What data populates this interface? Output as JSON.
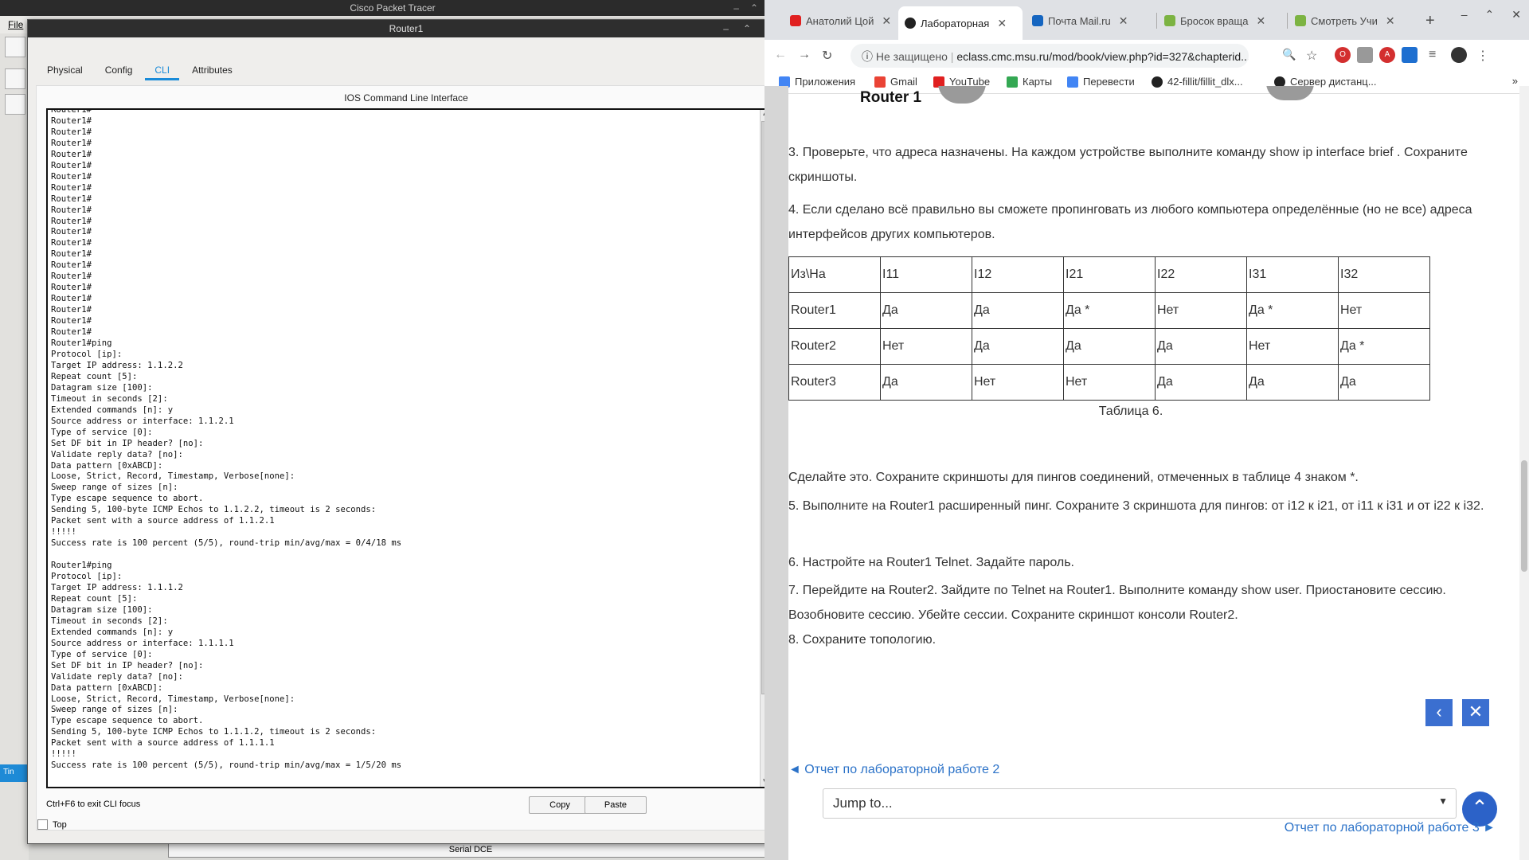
{
  "pt": {
    "app_title": "Cisco Packet Tracer",
    "menu_file": "File",
    "bottom_label": "Serial DCE",
    "side_tool_label": "Tin"
  },
  "dialog": {
    "title": "Router1",
    "tabs": [
      "Physical",
      "Config",
      "CLI",
      "Attributes"
    ],
    "active_tab": "CLI",
    "heading": "IOS Command Line Interface",
    "hint": "Ctrl+F6 to exit CLI focus",
    "copy_label": "Copy",
    "paste_label": "Paste",
    "top_label": "Top",
    "cli_text": "Router1#\nRouter1#\nRouter1#\nRouter1#\nRouter1#\nRouter1#\nRouter1#\nRouter1#\nRouter1#\nRouter1#\nRouter1#\nRouter1#\nRouter1#\nRouter1#\nRouter1#\nRouter1#\nRouter1#\nRouter1#\nRouter1#\nRouter1#\nRouter1#\nRouter1#ping\nProtocol [ip]:\nTarget IP address: 1.1.2.2\nRepeat count [5]:\nDatagram size [100]:\nTimeout in seconds [2]:\nExtended commands [n]: y\nSource address or interface: 1.1.2.1\nType of service [0]:\nSet DF bit in IP header? [no]:\nValidate reply data? [no]:\nData pattern [0xABCD]:\nLoose, Strict, Record, Timestamp, Verbose[none]:\nSweep range of sizes [n]:\nType escape sequence to abort.\nSending 5, 100-byte ICMP Echos to 1.1.2.2, timeout is 2 seconds:\nPacket sent with a source address of 1.1.2.1\n!!!!!\nSuccess rate is 100 percent (5/5), round-trip min/avg/max = 0/4/18 ms\n\nRouter1#ping\nProtocol [ip]:\nTarget IP address: 1.1.1.2\nRepeat count [5]:\nDatagram size [100]:\nTimeout in seconds [2]:\nExtended commands [n]: y\nSource address or interface: 1.1.1.1\nType of service [0]:\nSet DF bit in IP header? [no]:\nValidate reply data? [no]:\nData pattern [0xABCD]:\nLoose, Strict, Record, Timestamp, Verbose[none]:\nSweep range of sizes [n]:\nType escape sequence to abort.\nSending 5, 100-byte ICMP Echos to 1.1.1.2, timeout is 2 seconds:\nPacket sent with a source address of 1.1.1.1\n!!!!!\nSuccess rate is 100 percent (5/5), round-trip min/avg/max = 1/5/20 ms"
  },
  "browser": {
    "tabs": [
      {
        "label": "Анатолий Цой",
        "color": "#e02020"
      },
      {
        "label": "Лабораторная",
        "color": "#222222"
      },
      {
        "label": "Почта Mail.ru",
        "color": "#1565c0"
      },
      {
        "label": "Бросок враща",
        "color": "#7cb342"
      },
      {
        "label": "Смотреть Учи",
        "color": "#7cb342"
      }
    ],
    "security": "Не защищено",
    "url": "eclass.cmc.msu.ru/mod/book/view.php?id=327&chapterid...",
    "bookmarks": [
      "Приложения",
      "Gmail",
      "YouTube",
      "Карты",
      "Перевести",
      "42-fillit/fillit_dlx...",
      "Сервер дистанц..."
    ]
  },
  "content": {
    "router_label": "Router 1",
    "p3": "3. Проверьте, что адреса назначены. На каждом устройстве выполните команду show ip interface brief . Сохраните скриншоты.",
    "p4": "4. Если сделано всё правильно вы сможете пропинговать из любого компьютера определённые (но не все) адреса интерфейсов других компьютеров.",
    "table": {
      "header": [
        "Из\\На",
        "I11",
        "I12",
        "I21",
        "I22",
        "I31",
        "I32"
      ],
      "rows": [
        [
          "Router1",
          "Да",
          "Да",
          "Да *",
          "Нет",
          "Да *",
          "Нет"
        ],
        [
          "Router2",
          "Нет",
          "Да",
          "Да",
          "Да",
          "Нет",
          "Да *"
        ],
        [
          "Router3",
          "Да",
          "Нет",
          "Нет",
          "Да",
          "Да",
          "Да"
        ]
      ]
    },
    "caption": "Таблица 6.",
    "p_do": "Сделайте это. Сохраните скриншоты для пингов соединений, отмеченных в таблице 4 знаком *.",
    "p5": "5. Выполните на Router1 расширенный пинг. Сохраните 3 скриншота для пингов: от i12 к i21, от i11 к i31 и от i22 к i32.",
    "p6": "6. Настройте на Router1 Telnet. Задайте пароль.",
    "p7": "7. Перейдите на Router2. Зайдите по Telnet на Router1. Выполните команду show user. Приостановите сессию. Возобновите сессию. Убейте сессии. Сохраните скриншот консоли Router2.",
    "p8": "8. Сохраните топологию.",
    "prev": "◄ Отчет по лабораторной работе 2",
    "jump": "Jump to...",
    "next": "Отчет по лабораторной работе 3 ►"
  }
}
